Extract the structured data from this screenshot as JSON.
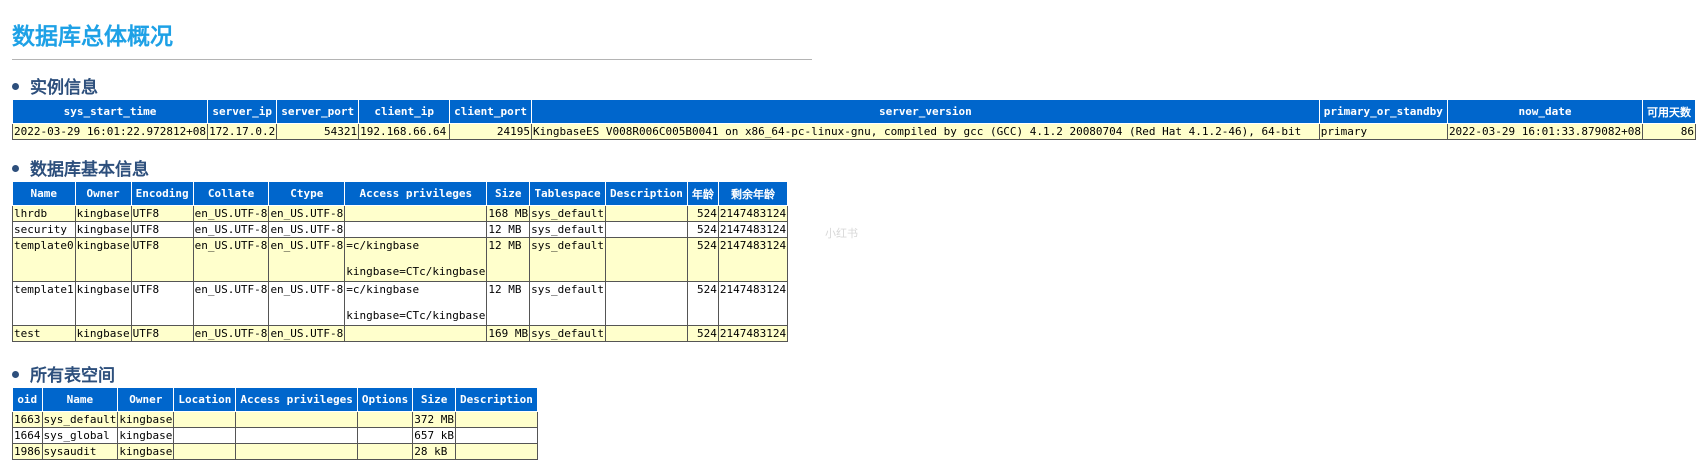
{
  "page": {
    "title": "数据库总体概况"
  },
  "sections": {
    "instance": "实例信息",
    "databases": "数据库基本信息",
    "tablespaces": "所有表空间"
  },
  "watermark": "小红书",
  "instance_table": {
    "headers": [
      "sys_start_time",
      "server_ip",
      "server_port",
      "client_ip",
      "client_port",
      "server_version",
      "primary_or_standby",
      "now_date",
      "可用天数"
    ],
    "rows": [
      [
        "2022-03-29 16:01:22.972812+08",
        "172.17.0.2",
        "54321",
        "192.168.66.64",
        "24195",
        "KingbaseES V008R006C005B0041 on x86_64-pc-linux-gnu, compiled by gcc (GCC) 4.1.2 20080704 (Red Hat 4.1.2-46), 64-bit",
        "primary",
        "2022-03-29 16:01:33.879082+08",
        "86"
      ]
    ]
  },
  "database_table": {
    "headers": [
      "Name",
      "Owner",
      "Encoding",
      "Collate",
      "Ctype",
      "Access privileges",
      "Size",
      "Tablespace",
      "Description",
      "年龄",
      "剩余年龄"
    ],
    "rows": [
      [
        "lhrdb",
        "kingbase",
        "UTF8",
        "en_US.UTF-8",
        "en_US.UTF-8",
        "",
        "168 MB",
        "sys_default",
        "",
        "524",
        "2147483124"
      ],
      [
        "security",
        "kingbase",
        "UTF8",
        "en_US.UTF-8",
        "en_US.UTF-8",
        "",
        "12 MB",
        "sys_default",
        "",
        "524",
        "2147483124"
      ],
      [
        "template0",
        "kingbase",
        "UTF8",
        "en_US.UTF-8",
        "en_US.UTF-8",
        "=c/kingbase",
        "12 MB",
        "sys_default",
        "",
        "524",
        "2147483124"
      ],
      [
        "template1",
        "kingbase",
        "UTF8",
        "en_US.UTF-8",
        "en_US.UTF-8",
        "=c/kingbase",
        "12 MB",
        "sys_default",
        "",
        "524",
        "2147483124"
      ],
      [
        "test",
        "kingbase",
        "UTF8",
        "en_US.UTF-8",
        "en_US.UTF-8",
        "",
        "169 MB",
        "sys_default",
        "",
        "524",
        "2147483124"
      ]
    ],
    "privileges_line2": [
      "",
      "",
      "kingbase=CTc/kingbase",
      "kingbase=CTc/kingbase",
      ""
    ]
  },
  "tablespace_table": {
    "headers": [
      "oid",
      "Name",
      "Owner",
      "Location",
      "Access privileges",
      "Options",
      "Size",
      "Description"
    ],
    "rows": [
      [
        "1663",
        "sys_default",
        "kingbase",
        "",
        "",
        "",
        "372 MB",
        ""
      ],
      [
        "1664",
        "sys_global",
        "kingbase",
        "",
        "",
        "",
        "657 kB",
        ""
      ],
      [
        "1986",
        "sysaudit",
        "kingbase",
        "",
        "",
        "",
        "28 kB",
        ""
      ]
    ]
  }
}
